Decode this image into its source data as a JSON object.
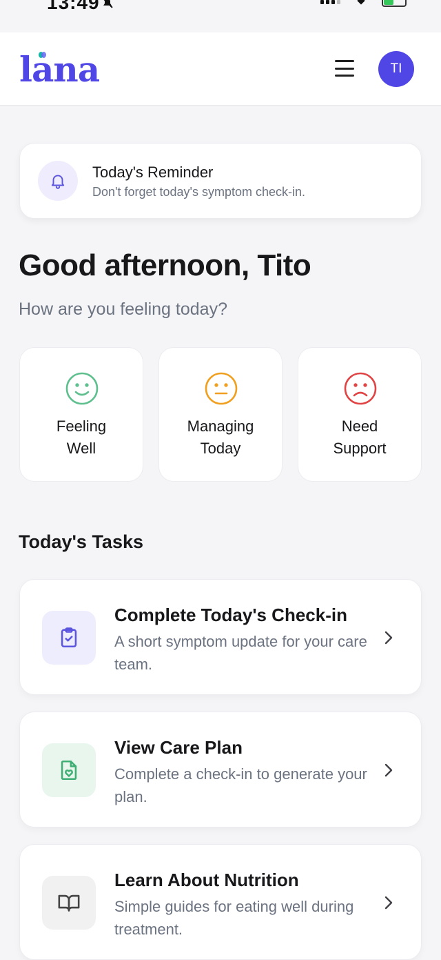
{
  "status_bar": {
    "time": "13:49"
  },
  "header": {
    "logo_text": "lana",
    "avatar_initials": "TI",
    "brand_color": "#4f46e5"
  },
  "reminder": {
    "title": "Today's Reminder",
    "subtitle": "Don't forget today's symptom check-in.",
    "icon": "bell-icon"
  },
  "greeting": {
    "title": "Good afternoon, Tito",
    "prompt": "How are you feeling today?"
  },
  "moods": [
    {
      "label": "Feeling\nWell",
      "icon": "smile-icon",
      "color": "#5fbf8f"
    },
    {
      "label": "Managing\nToday",
      "icon": "neutral-face-icon",
      "color": "#f0a020"
    },
    {
      "label": "Need\nSupport",
      "icon": "frown-icon",
      "color": "#e04545"
    }
  ],
  "tasks_section": {
    "title": "Today's Tasks",
    "items": [
      {
        "title": "Complete Today's Check-in",
        "description": "A short symptom update for your care team.",
        "icon": "clipboard-check-icon",
        "icon_bg": "#eeedfd",
        "icon_color": "#5b55e0"
      },
      {
        "title": "View Care Plan",
        "description": "Complete a check-in to generate your plan.",
        "icon": "heart-document-icon",
        "icon_bg": "#e8f6ee",
        "icon_color": "#3fae74"
      },
      {
        "title": "Learn About Nutrition",
        "description": "Simple guides for eating well during treatment.",
        "icon": "book-icon",
        "icon_bg": "#f1f1f2",
        "icon_color": "#555"
      }
    ]
  }
}
